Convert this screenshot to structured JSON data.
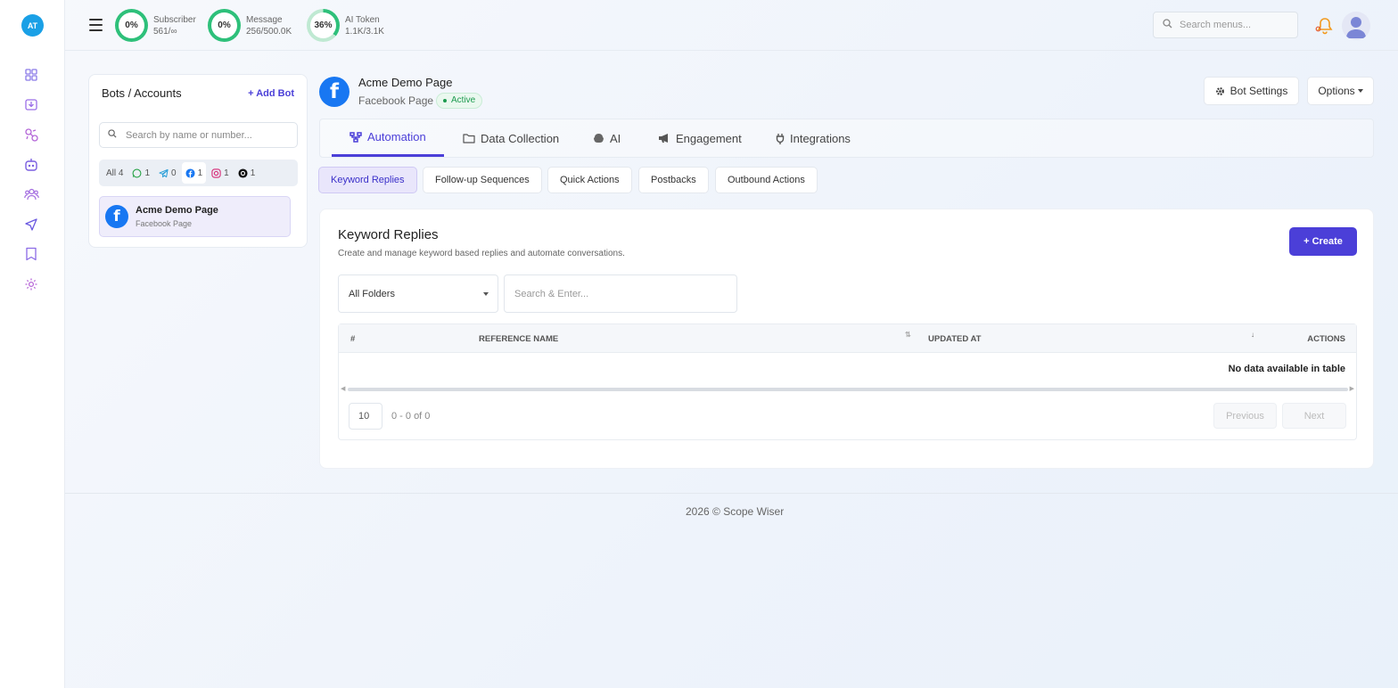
{
  "app": {
    "logo_initials": "AT"
  },
  "rail": {
    "icons": [
      "dashboard-icon",
      "inbox-icon",
      "integrations-icon",
      "bot-icon",
      "contacts-icon",
      "broadcast-icon",
      "bookmark-icon",
      "settings-icon"
    ]
  },
  "header": {
    "stats": [
      {
        "percent": "0%",
        "label": "Subscriber",
        "value": "561/∞",
        "fraction": 0.0
      },
      {
        "percent": "0%",
        "label": "Message",
        "value": "256/500.0K",
        "fraction": 0.0
      },
      {
        "percent": "36%",
        "label": "AI Token",
        "value": "1.1K/3.1K",
        "fraction": 0.36
      }
    ],
    "search_placeholder": "Search menus...",
    "ring_color": "#2ec07a"
  },
  "bots": {
    "title": "Bots / Accounts",
    "add_label": "+ Add Bot",
    "search_placeholder": "Search by name or number...",
    "filters": [
      {
        "label": "All",
        "count": "4"
      },
      {
        "icon": "whatsapp-icon",
        "count": "1"
      },
      {
        "icon": "telegram-icon",
        "count": "0"
      },
      {
        "icon": "facebook-icon",
        "count": "1"
      },
      {
        "icon": "instagram-icon",
        "count": "1"
      },
      {
        "icon": "threads-icon",
        "count": "1"
      }
    ],
    "items": [
      {
        "name": "Acme Demo Page",
        "type": "Facebook Page"
      }
    ]
  },
  "page": {
    "name": "Acme Demo Page",
    "type": "Facebook Page",
    "status": "Active",
    "bot_settings_label": "Bot Settings",
    "options_label": "Options"
  },
  "tabs": [
    {
      "label": "Automation",
      "icon": "automation-icon",
      "active": true
    },
    {
      "label": "Data Collection",
      "icon": "folder-icon"
    },
    {
      "label": "AI",
      "icon": "brain-icon"
    },
    {
      "label": "Engagement",
      "icon": "megaphone-icon"
    },
    {
      "label": "Integrations",
      "icon": "plug-icon"
    }
  ],
  "subtabs": [
    {
      "label": "Keyword Replies",
      "active": true
    },
    {
      "label": "Follow-up Sequences"
    },
    {
      "label": "Quick Actions"
    },
    {
      "label": "Postbacks"
    },
    {
      "label": "Outbound Actions"
    }
  ],
  "content": {
    "title": "Keyword Replies",
    "subtitle": "Create and manage keyword based replies and automate conversations.",
    "create_label": "+ Create",
    "folder_selected": "All Folders",
    "search_placeholder": "Search & Enter...",
    "table": {
      "columns": [
        "#",
        "REFERENCE NAME",
        "UPDATED AT",
        "ACTIONS"
      ],
      "empty_text": "No data available in table",
      "per_page": "10",
      "page_info": "0 - 0 of 0",
      "previous_label": "Previous",
      "next_label": "Next"
    }
  },
  "footer": {
    "text": "2026 © Scope Wiser"
  },
  "colors": {
    "accent": "#4b3fd8",
    "facebook": "#1877f2",
    "success": "#1d9b50"
  }
}
